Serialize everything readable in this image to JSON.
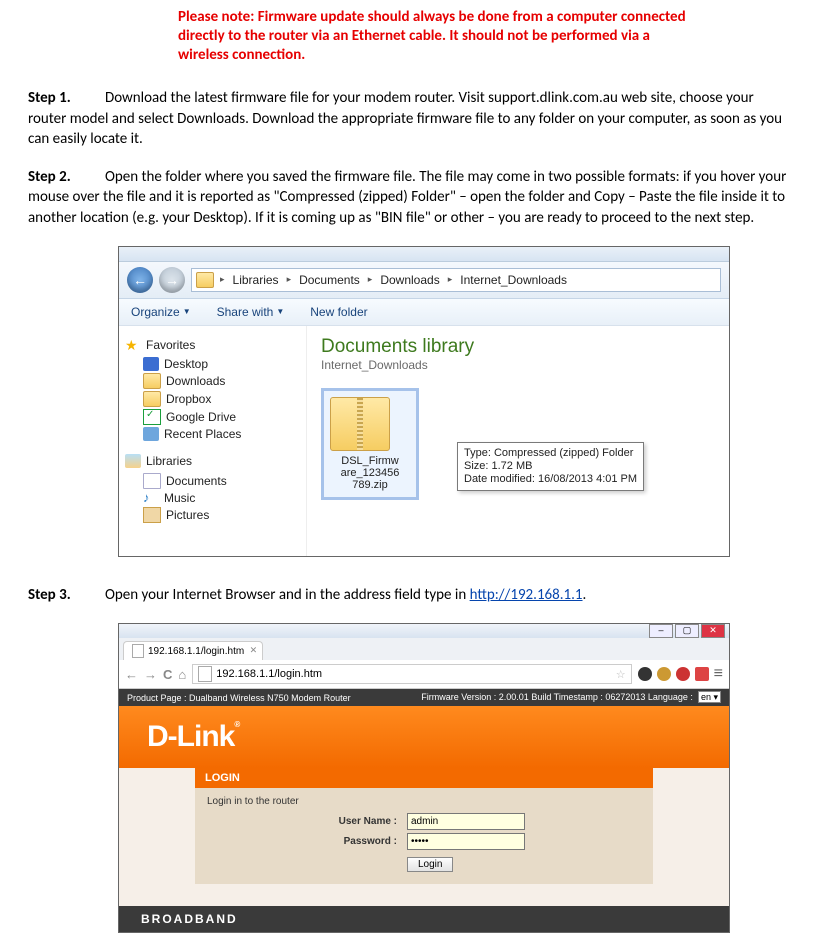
{
  "warning": "Please note: Firmware update should always be done from a computer connected directly to the router via an Ethernet cable. It should not be performed via a wireless connection.",
  "steps": {
    "s1": {
      "label": "Step 1.",
      "text": "Download the latest firmware file for your modem router. Visit support.dlink.com.au web site, choose your router model and select Downloads. Download the appropriate firmware file to any folder on your computer, as soon as you can easily locate it."
    },
    "s2": {
      "label": "Step 2.",
      "text": "Open the folder where you saved the firmware file. The file may come in two possible formats: if you hover your mouse over the file and it is reported as \"Compressed (zipped) Folder\" – open the folder and Copy – Paste the file inside it to another location (e.g. your Desktop). If it is coming up as \"BIN file\" or other – you are ready to proceed to the next step."
    },
    "s3": {
      "label": "Step 3.",
      "text_before": "Open your Internet Browser and in the address field type in ",
      "link": "http://192.168.1.1",
      "text_after": "."
    }
  },
  "explorer": {
    "crumbs": [
      "Libraries",
      "Documents",
      "Downloads",
      "Internet_Downloads"
    ],
    "toolbar": {
      "organize": "Organize",
      "share": "Share with",
      "newfolder": "New folder"
    },
    "nav": {
      "favorites": "Favorites",
      "desktop": "Desktop",
      "downloads": "Downloads",
      "dropbox": "Dropbox",
      "gdrive": "Google Drive",
      "recent": "Recent Places",
      "libraries": "Libraries",
      "documents": "Documents",
      "music": "Music",
      "pictures": "Pictures"
    },
    "libtitle": "Documents library",
    "libsub": "Internet_Downloads",
    "file": {
      "name1": "DSL_Firmw",
      "name2": "are_123456",
      "name3": "789.zip"
    },
    "tooltip": {
      "type": "Type: Compressed (zipped) Folder",
      "size": "Size: 1.72 MB",
      "date": "Date modified: 16/08/2013 4:01 PM"
    }
  },
  "browser": {
    "tab_title": "192.168.1.1/login.htm",
    "url": "192.168.1.1/login.htm"
  },
  "router": {
    "product": "Product Page : Dualband Wireless N750 Modem Router",
    "meta": "Firmware Version : 2.00.01   Build Timestamp : 06272013   Language :",
    "lang": "en",
    "logo": "D-Link",
    "login_head": "LOGIN",
    "login_hint": "Login in to the router",
    "user_lbl": "User Name :",
    "user_val": "admin",
    "pass_lbl": "Password :",
    "pass_val": "•••••",
    "login_btn": "Login",
    "bb": "BROADBAND"
  }
}
